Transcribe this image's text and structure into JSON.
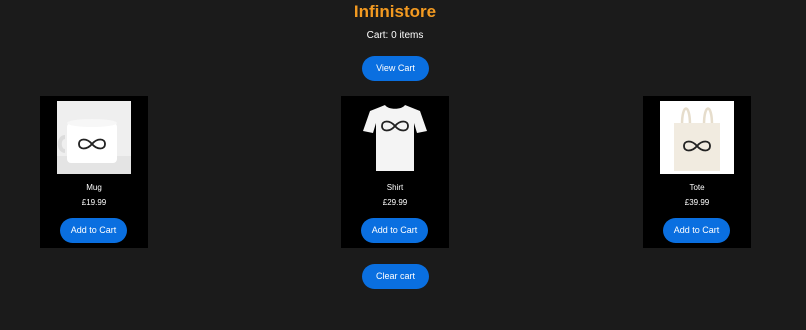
{
  "store": {
    "title": "Infinistore",
    "cart_status": "Cart: 0 items",
    "view_cart_label": "View Cart",
    "clear_cart_label": "Clear cart"
  },
  "products": [
    {
      "name": "Mug",
      "price": "£19.99",
      "button_label": "Add to Cart",
      "icon": "mug-icon"
    },
    {
      "name": "Shirt",
      "price": "£29.99",
      "button_label": "Add to Cart",
      "icon": "shirt-icon"
    },
    {
      "name": "Tote",
      "price": "£39.99",
      "button_label": "Add to Cart",
      "icon": "tote-bag-icon"
    }
  ],
  "colors": {
    "background": "#1b1b1b",
    "title": "#f39a21",
    "button": "#0a6fe0",
    "card": "#000000"
  }
}
